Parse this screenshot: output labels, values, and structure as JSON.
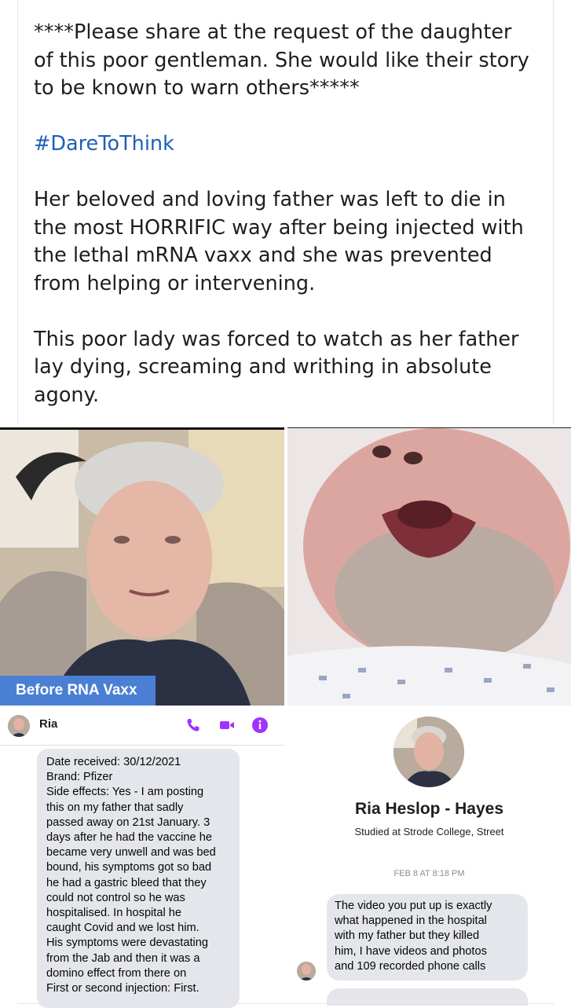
{
  "post": {
    "paragraphs": [
      "****Please share at the request of the daughter of this poor gentleman. She would like their story to be known to warn others*****",
      "#DareToThink",
      "Her beloved and loving father was left to die in the most HORRIFIC way after being injected with the lethal mRNA vaxx and she was prevented from helping or intervening.",
      "This poor lady was forced to watch as her father lay dying, screaming and writhing in absolute agony."
    ]
  },
  "photos": {
    "left_caption": "Before RNA Vaxx"
  },
  "chat": {
    "contact_name": "Ria",
    "header_icons": [
      "phone-icon",
      "video-icon",
      "info-icon"
    ],
    "accent_color": "#a033ff",
    "message_lines": [
      "Date received: 30/12/2021",
      "Brand: Pfizer",
      "Side effects: Yes - I am posting",
      "this on my father that sadly",
      "passed away on 21st January.  3",
      "days after he had the vaccine he",
      "became very unwell and was bed",
      "bound, his symptoms got so bad",
      "he had a gastric bleed that they",
      "could not control so he was",
      "hospitalised. In hospital he",
      "caught Covid and we lost him.",
      "His symptoms were devastating",
      "from the Jab and then it was a",
      "domino effect from there on",
      "First or second injection: First."
    ]
  },
  "profile": {
    "name": "Ria Heslop - Hayes",
    "subtitle": "Studied at Strode College, Street",
    "timestamp": "FEB 8 AT 8:18 PM",
    "message_lines": [
      "The video you put up is exactly",
      "what happened in the hospital",
      "with my father but they killed",
      "him, I have videos and photos",
      "and 109 recorded phone calls"
    ]
  }
}
